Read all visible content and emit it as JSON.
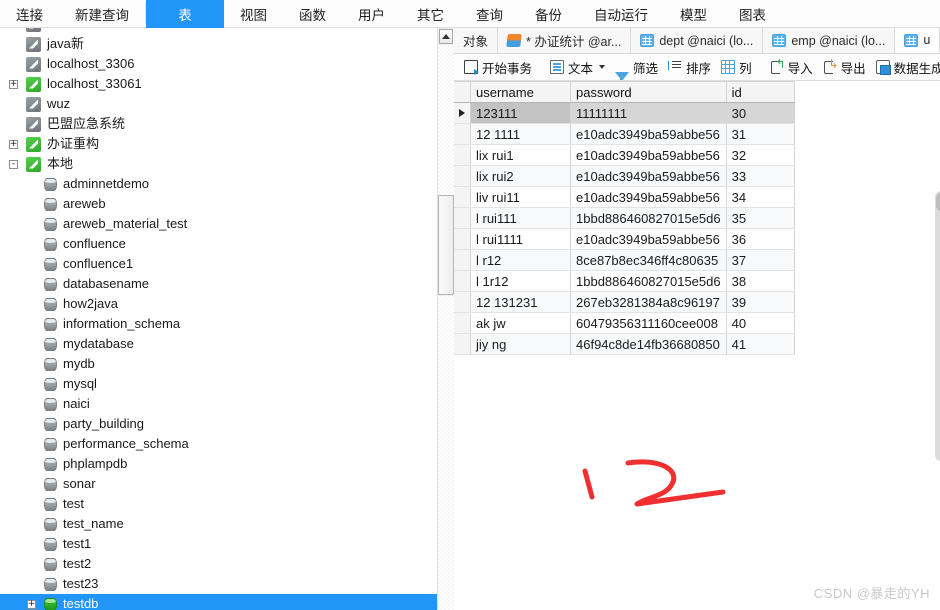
{
  "menubar": {
    "items": [
      {
        "label": "连接",
        "selected": false
      },
      {
        "label": "新建查询",
        "selected": false
      },
      {
        "label": "表",
        "selected": true
      },
      {
        "label": "视图",
        "selected": false
      },
      {
        "label": "函数",
        "selected": false
      },
      {
        "label": "用户",
        "selected": false
      },
      {
        "label": "其它",
        "selected": false
      },
      {
        "label": "查询",
        "selected": false
      },
      {
        "label": "备份",
        "selected": false
      },
      {
        "label": "自动运行",
        "selected": false
      },
      {
        "label": "模型",
        "selected": false
      },
      {
        "label": "图表",
        "selected": false
      }
    ]
  },
  "tree": {
    "connections": [
      {
        "label": "java新",
        "icon": "connection-icon",
        "color": "gray",
        "expander": "",
        "indent": 1,
        "type": "connection"
      },
      {
        "label": "localhost_3306",
        "icon": "connection-icon",
        "color": "gray",
        "expander": "",
        "indent": 1,
        "type": "connection"
      },
      {
        "label": "localhost_33061",
        "icon": "connection-icon",
        "color": "green",
        "expander": "+",
        "indent": 1,
        "type": "connection"
      },
      {
        "label": "wuz",
        "icon": "connection-icon",
        "color": "gray",
        "expander": "",
        "indent": 1,
        "type": "connection"
      },
      {
        "label": "巴盟应急系统",
        "icon": "connection-icon",
        "color": "gray",
        "expander": "",
        "indent": 1,
        "type": "connection"
      },
      {
        "label": "办证重构",
        "icon": "connection-icon",
        "color": "green",
        "expander": "+",
        "indent": 1,
        "type": "connection"
      },
      {
        "label": "本地",
        "icon": "connection-icon",
        "color": "green",
        "expander": "-",
        "indent": 1,
        "type": "connection"
      },
      {
        "label": "adminnetdemo",
        "icon": "database-icon",
        "color": "gray",
        "expander": "",
        "indent": 2,
        "type": "database"
      },
      {
        "label": "areweb",
        "icon": "database-icon",
        "color": "gray",
        "expander": "",
        "indent": 2,
        "type": "database"
      },
      {
        "label": "areweb_material_test",
        "icon": "database-icon",
        "color": "gray",
        "expander": "",
        "indent": 2,
        "type": "database"
      },
      {
        "label": "confluence",
        "icon": "database-icon",
        "color": "gray",
        "expander": "",
        "indent": 2,
        "type": "database"
      },
      {
        "label": "confluence1",
        "icon": "database-icon",
        "color": "gray",
        "expander": "",
        "indent": 2,
        "type": "database"
      },
      {
        "label": "databasename",
        "icon": "database-icon",
        "color": "gray",
        "expander": "",
        "indent": 2,
        "type": "database"
      },
      {
        "label": "how2java",
        "icon": "database-icon",
        "color": "gray",
        "expander": "",
        "indent": 2,
        "type": "database"
      },
      {
        "label": "information_schema",
        "icon": "database-icon",
        "color": "gray",
        "expander": "",
        "indent": 2,
        "type": "database"
      },
      {
        "label": "mydatabase",
        "icon": "database-icon",
        "color": "gray",
        "expander": "",
        "indent": 2,
        "type": "database"
      },
      {
        "label": "mydb",
        "icon": "database-icon",
        "color": "gray",
        "expander": "",
        "indent": 2,
        "type": "database"
      },
      {
        "label": "mysql",
        "icon": "database-icon",
        "color": "gray",
        "expander": "",
        "indent": 2,
        "type": "database"
      },
      {
        "label": "naici",
        "icon": "database-icon",
        "color": "gray",
        "expander": "",
        "indent": 2,
        "type": "database"
      },
      {
        "label": "party_building",
        "icon": "database-icon",
        "color": "gray",
        "expander": "",
        "indent": 2,
        "type": "database"
      },
      {
        "label": "performance_schema",
        "icon": "database-icon",
        "color": "gray",
        "expander": "",
        "indent": 2,
        "type": "database"
      },
      {
        "label": "phplampdb",
        "icon": "database-icon",
        "color": "gray",
        "expander": "",
        "indent": 2,
        "type": "database"
      },
      {
        "label": "sonar",
        "icon": "database-icon",
        "color": "gray",
        "expander": "",
        "indent": 2,
        "type": "database"
      },
      {
        "label": "test",
        "icon": "database-icon",
        "color": "gray",
        "expander": "",
        "indent": 2,
        "type": "database"
      },
      {
        "label": "test_name",
        "icon": "database-icon",
        "color": "gray",
        "expander": "",
        "indent": 2,
        "type": "database"
      },
      {
        "label": "test1",
        "icon": "database-icon",
        "color": "gray",
        "expander": "",
        "indent": 2,
        "type": "database"
      },
      {
        "label": "test2",
        "icon": "database-icon",
        "color": "gray",
        "expander": "",
        "indent": 2,
        "type": "database"
      },
      {
        "label": "test23",
        "icon": "database-icon",
        "color": "gray",
        "expander": "",
        "indent": 2,
        "type": "database"
      },
      {
        "label": "testdb",
        "icon": "database-icon",
        "color": "green",
        "expander": "+",
        "indent": 2,
        "type": "database",
        "selected": true
      }
    ]
  },
  "tabs": {
    "items": [
      {
        "label": "对象",
        "icon": "none",
        "active": false
      },
      {
        "label": "* 办证统计 @ar...",
        "icon": "query-icon",
        "active": false
      },
      {
        "label": "dept @naici (lo...",
        "icon": "table-icon",
        "active": false
      },
      {
        "label": "emp @naici (lo...",
        "icon": "table-icon",
        "active": false
      },
      {
        "label": "u",
        "icon": "table-icon",
        "active": true
      }
    ]
  },
  "toolbar": {
    "buttons": [
      {
        "label": "开始事务",
        "icon": "transaction-icon",
        "caret": false
      },
      {
        "label": "文本",
        "icon": "text-icon",
        "caret": true
      },
      {
        "label": "筛选",
        "icon": "filter-icon",
        "caret": false
      },
      {
        "label": "排序",
        "icon": "sort-icon",
        "caret": false
      },
      {
        "label": "列",
        "icon": "columns-icon",
        "caret": false
      },
      {
        "label": "导入",
        "icon": "import-icon",
        "caret": false
      },
      {
        "label": "导出",
        "icon": "export-icon",
        "caret": false
      },
      {
        "label": "数据生成",
        "icon": "data-generate-icon",
        "caret": false
      }
    ]
  },
  "grid": {
    "columns": [
      "username",
      "password",
      "id"
    ],
    "rows": [
      {
        "username": "123111",
        "password": "11111111",
        "id": "30",
        "current": true
      },
      {
        "username": "12 1111",
        "password": "e10adc3949ba59abbe56",
        "id": "31"
      },
      {
        "username": "lix rui1",
        "password": "e10adc3949ba59abbe56",
        "id": "32"
      },
      {
        "username": "lix rui2",
        "password": "e10adc3949ba59abbe56",
        "id": "33"
      },
      {
        "username": "liv rui11",
        "password": "e10adc3949ba59abbe56",
        "id": "34"
      },
      {
        "username": "l  rui111",
        "password": "1bbd886460827015e5d6",
        "id": "35"
      },
      {
        "username": "l  rui1111",
        "password": "e10adc3949ba59abbe56",
        "id": "36"
      },
      {
        "username": "l  r12",
        "password": "8ce87b8ec346ff4c80635",
        "id": "37"
      },
      {
        "username": "l  1r12",
        "password": "1bbd886460827015e5d6",
        "id": "38"
      },
      {
        "username": "12 131231",
        "password": "267eb3281384a8c96197",
        "id": "39"
      },
      {
        "username": "ak  jw",
        "password": "60479356311160cee008",
        "id": "40"
      },
      {
        "username": "jiy ng",
        "password": "46f94c8de14fb36680850",
        "id": "41"
      }
    ]
  },
  "annotations": {
    "marks": [
      "1",
      "2"
    ],
    "color": "#f03030"
  },
  "watermark": {
    "text": "CSDN @暴走的YH"
  }
}
